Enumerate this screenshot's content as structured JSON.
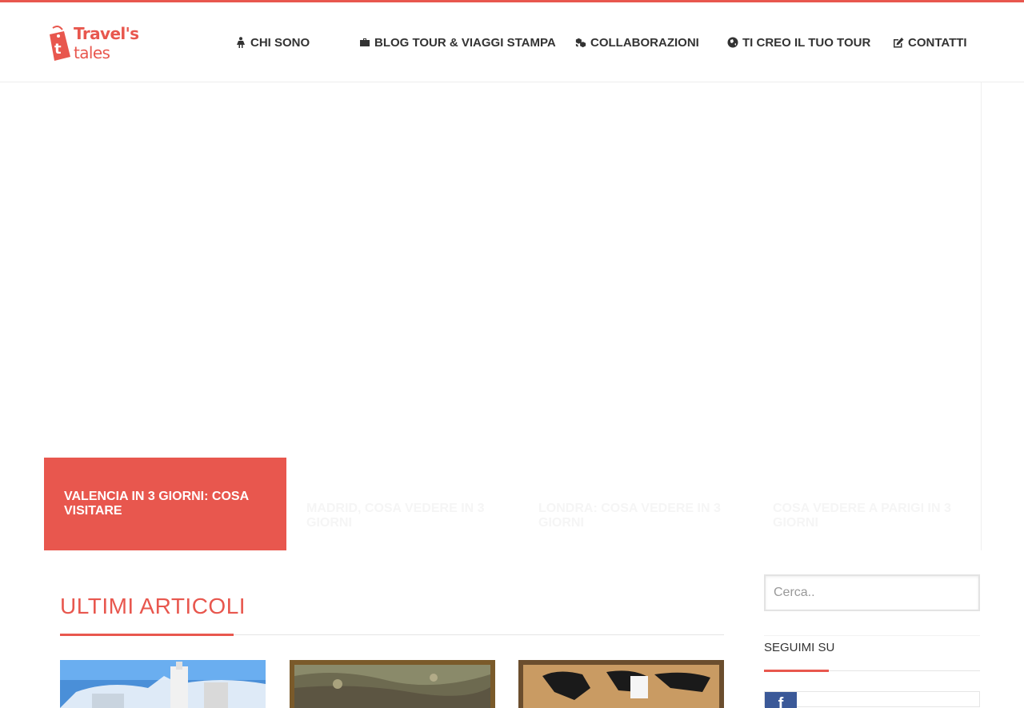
{
  "brand": {
    "name_bold": "Travel's",
    "name_light": " tales",
    "accent_color": "#e8574e"
  },
  "nav": [
    {
      "icon": "female-icon",
      "label": "CHI SONO"
    },
    {
      "icon": "briefcase-icon",
      "label": "BLOG TOUR & VIAGGI STAMPA"
    },
    {
      "icon": "cubes-icon",
      "label": "COLLABORAZIONI"
    },
    {
      "icon": "globe-icon",
      "label": "TI CREO IL TUO TOUR"
    },
    {
      "icon": "edit-icon",
      "label": "CONTATTI"
    }
  ],
  "slider": {
    "tabs": [
      {
        "label": "VALENCIA IN 3 GIORNI: COSA VISITARE",
        "active": true
      },
      {
        "label": "MADRID, COSA VEDERE IN 3 GIORNI",
        "active": false
      },
      {
        "label": "LONDRA: COSA VEDERE IN 3 GIORNI",
        "active": false
      },
      {
        "label": "COSA VEDERE A PARIGI IN 3 GIORNI",
        "active": false
      }
    ]
  },
  "main": {
    "section_title": "ULTIMI ARTICOLI"
  },
  "sidebar": {
    "search_placeholder": "Cerca..",
    "follow_title": "SEGUIMI SU",
    "facebook_glyph": "f"
  }
}
